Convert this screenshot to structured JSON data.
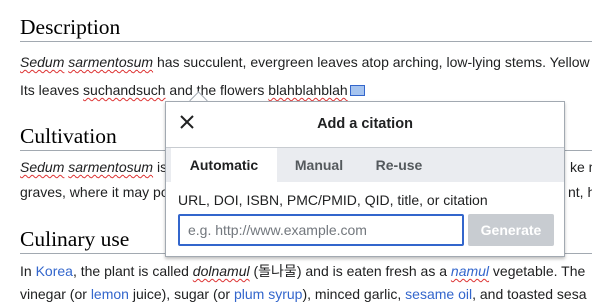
{
  "article": {
    "sections": [
      {
        "heading": "Description",
        "lines": [
          [
            "Sedum",
            " ",
            "sarmentosum",
            " has succulent, evergreen leaves atop arching, low-lying stems. Yellow"
          ],
          [
            "Its leaves ",
            "suchandsuch",
            " and the flowers ",
            "blahblahblah"
          ]
        ]
      },
      {
        "heading": "Cultivation",
        "lines": [
          [
            "Sedum",
            " ",
            "sarmentosum",
            " is",
            "ke m"
          ],
          [
            "graves, where it may po",
            "nt, h"
          ]
        ]
      },
      {
        "heading": "Culinary use",
        "lines": [
          [
            "In ",
            "Korea",
            ", the plant is called ",
            "dolnamul",
            " (돌나물) and is eaten fresh as a ",
            "namul",
            " vegetable. The"
          ],
          [
            "vinegar (or ",
            "lemon",
            " juice), sugar (or ",
            "plum syrup",
            "), minced garlic, ",
            "sesame oil",
            ", and toasted sesa"
          ]
        ]
      }
    ]
  },
  "citation_dialog": {
    "title": "Add a citation",
    "tabs": [
      "Automatic",
      "Manual",
      "Re-use"
    ],
    "active_tab": "Automatic",
    "field_label": "URL, DOI, ISBN, PMC/PMID, QID, title, or citation",
    "input_value": "",
    "input_placeholder": "e.g. http://www.example.com",
    "generate_label": "Generate"
  },
  "icons": {
    "close": "close-icon",
    "citation_marker": "citation-marker-icon"
  },
  "colors": {
    "link": "#3366cc",
    "spellcheck": "#dd3333",
    "primary": "#3366cc",
    "disabled_button": "#c8ccd1",
    "tab_bar": "#eaecf0"
  }
}
